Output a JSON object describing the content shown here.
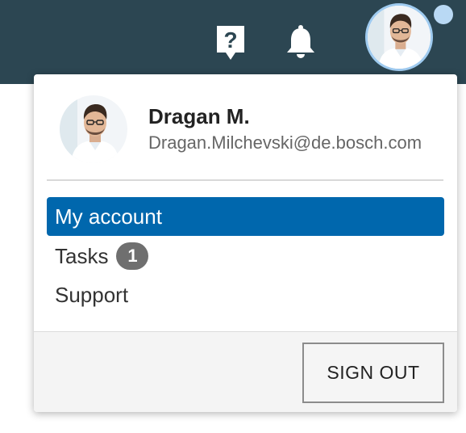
{
  "header": {
    "help_icon": "help-question-icon",
    "notifications_icon": "bell-icon",
    "avatar_icon": "user-avatar"
  },
  "user": {
    "name": "Dragan M.",
    "email": "Dragan.Milchevski@de.bosch.com"
  },
  "menu": {
    "items": [
      {
        "label": "My account",
        "active": true
      },
      {
        "label": "Tasks",
        "badge": "1"
      },
      {
        "label": "Support"
      }
    ]
  },
  "footer": {
    "sign_out_label": "SIGN OUT"
  },
  "colors": {
    "topbar": "#2c4652",
    "accent": "#0067ad",
    "badge": "#6f6f6f",
    "avatar_ring": "#9fcbf0"
  }
}
